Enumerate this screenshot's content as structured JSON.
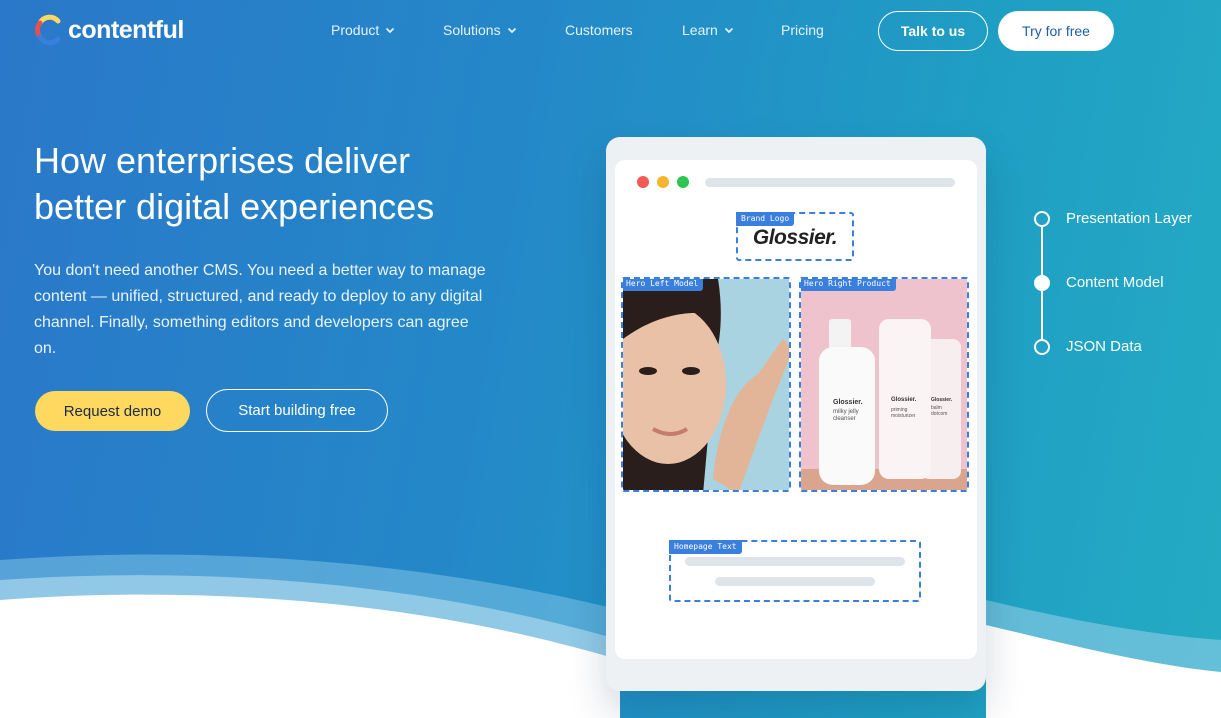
{
  "brand": {
    "name": "contentful"
  },
  "nav": {
    "items": [
      {
        "label": "Product",
        "dropdown": true
      },
      {
        "label": "Solutions",
        "dropdown": true
      },
      {
        "label": "Customers",
        "dropdown": false
      },
      {
        "label": "Learn",
        "dropdown": true
      },
      {
        "label": "Pricing",
        "dropdown": false
      }
    ],
    "talk_label": "Talk to us",
    "try_label": "Try for free"
  },
  "hero": {
    "title_line1": "How enterprises deliver",
    "title_line2": "better digital experiences",
    "subtitle": "You don't need another CMS. You need a better way to manage content — unified, structured, and ready to deploy to any digital channel. Finally, something editors and developers can agree on.",
    "demo_label": "Request demo",
    "build_label": "Start building free"
  },
  "mockup": {
    "brand_logo_tag": "Brand Logo",
    "brand_logo_text": "Glossier.",
    "hero_left_tag": "Hero Left Model",
    "hero_right_tag": "Hero Right Product",
    "homepage_text_tag": "Homepage Text",
    "bottle_brand": "Glossier.",
    "bottle1_name": "milky jelly cleanser",
    "bottle2_name": "priming moisturizer",
    "bottle3_name": "balm dotcom"
  },
  "timeline": {
    "items": [
      {
        "label": "Presentation Layer",
        "active": false
      },
      {
        "label": "Content Model",
        "active": true
      },
      {
        "label": "JSON Data",
        "active": false
      }
    ]
  },
  "colors": {
    "accent_yellow": "#ffd85f",
    "zone_blue": "#3a7fdd",
    "bg_blue": "#2a78c9",
    "bg_teal": "#24abc3"
  }
}
